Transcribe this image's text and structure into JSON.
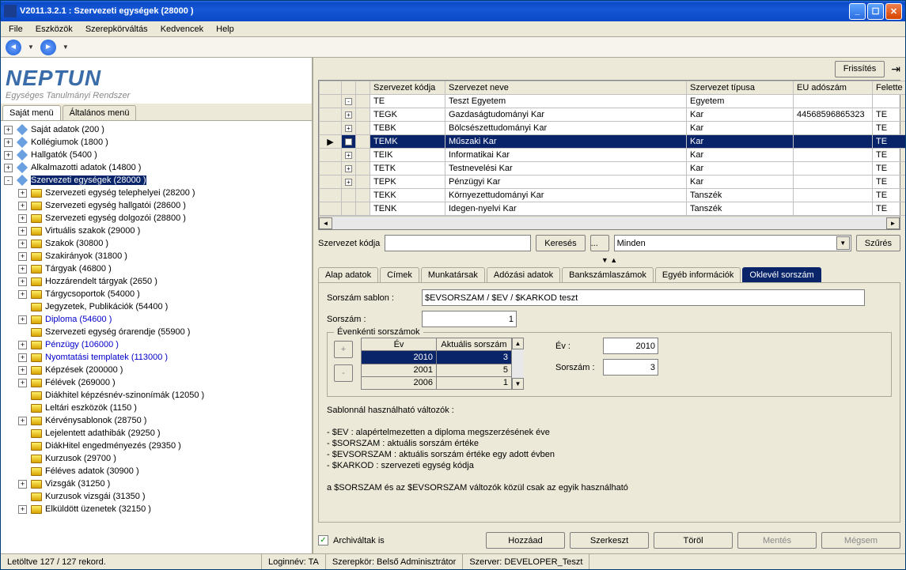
{
  "title": "V2011.3.2.1 : Szervezeti egységek (28000  )",
  "menu": [
    "File",
    "Eszközök",
    "Szerepkörváltás",
    "Kedvencek",
    "Help"
  ],
  "logo": {
    "title": "NEPTUN",
    "subtitle": "Egységes Tanulmányi Rendszer"
  },
  "left_tabs": {
    "own": "Saját menü",
    "general": "Általános menü"
  },
  "tree": [
    {
      "lvl": 0,
      "pm": "+",
      "icon": "diamond",
      "label": "Saját adatok (200  )"
    },
    {
      "lvl": 0,
      "pm": "+",
      "icon": "diamond",
      "label": "Kollégiumok (1800  )"
    },
    {
      "lvl": 0,
      "pm": "+",
      "icon": "diamond",
      "label": "Hallgatók (5400  )"
    },
    {
      "lvl": 0,
      "pm": "+",
      "icon": "diamond",
      "label": "Alkalmazotti adatok (14800  )"
    },
    {
      "lvl": 0,
      "pm": "-",
      "icon": "diamond",
      "label": "Szervezeti egységek (28000  )",
      "sel": true
    },
    {
      "lvl": 1,
      "pm": "+",
      "icon": "folder",
      "label": "Szervezeti egység telephelyei (28200  )"
    },
    {
      "lvl": 1,
      "pm": "+",
      "icon": "folder",
      "label": "Szervezeti egység hallgatói (28600  )"
    },
    {
      "lvl": 1,
      "pm": "+",
      "icon": "folder",
      "label": "Szervezeti egység dolgozói (28800  )"
    },
    {
      "lvl": 1,
      "pm": "+",
      "icon": "folder",
      "label": "Virtuális szakok (29000  )"
    },
    {
      "lvl": 1,
      "pm": "+",
      "icon": "folder",
      "label": "Szakok (30800  )"
    },
    {
      "lvl": 1,
      "pm": "+",
      "icon": "folder",
      "label": "Szakirányok (31800  )"
    },
    {
      "lvl": 1,
      "pm": "+",
      "icon": "folder",
      "label": "Tárgyak (46800  )"
    },
    {
      "lvl": 1,
      "pm": "+",
      "icon": "folder",
      "label": "Hozzárendelt tárgyak (2650  )"
    },
    {
      "lvl": 1,
      "pm": "+",
      "icon": "folder",
      "label": "Tárgycsoportok (54000  )"
    },
    {
      "lvl": 1,
      "pm": "",
      "icon": "folder",
      "label": "Jegyzetek, Publikációk (54400  )"
    },
    {
      "lvl": 1,
      "pm": "+",
      "icon": "folder",
      "label": "Diploma (54600  )",
      "blue": true
    },
    {
      "lvl": 1,
      "pm": "",
      "icon": "folder",
      "label": "Szervezeti egység órarendje (55900  )"
    },
    {
      "lvl": 1,
      "pm": "+",
      "icon": "folder",
      "label": "Pénzügy (106000  )",
      "blue": true
    },
    {
      "lvl": 1,
      "pm": "+",
      "icon": "folder",
      "label": "Nyomtatási templatek (113000  )",
      "blue": true
    },
    {
      "lvl": 1,
      "pm": "+",
      "icon": "folder",
      "label": "Képzések (200000  )"
    },
    {
      "lvl": 1,
      "pm": "+",
      "icon": "folder",
      "label": "Félévek (269000  )"
    },
    {
      "lvl": 1,
      "pm": "",
      "icon": "folder",
      "label": "Diákhitel képzésnév-szinonímák (12050  )"
    },
    {
      "lvl": 1,
      "pm": "",
      "icon": "folder",
      "label": "Leltári eszközök (1150  )"
    },
    {
      "lvl": 1,
      "pm": "+",
      "icon": "folder",
      "label": "Kérvénysablonok (28750  )"
    },
    {
      "lvl": 1,
      "pm": "",
      "icon": "folder",
      "label": "Lejelentett adathibák (29250  )"
    },
    {
      "lvl": 1,
      "pm": "",
      "icon": "folder",
      "label": "DiákHitel engedményezés (29350  )"
    },
    {
      "lvl": 1,
      "pm": "",
      "icon": "folder",
      "label": "Kurzusok (29700  )"
    },
    {
      "lvl": 1,
      "pm": "",
      "icon": "folder",
      "label": "Féléves adatok (30900  )"
    },
    {
      "lvl": 1,
      "pm": "+",
      "icon": "folder",
      "label": "Vizsgák (31250  )"
    },
    {
      "lvl": 1,
      "pm": "",
      "icon": "folder",
      "label": "Kurzusok vizsgái (31350  )"
    },
    {
      "lvl": 1,
      "pm": "+",
      "icon": "folder",
      "label": "Elküldött üzenetek (32150  )"
    }
  ],
  "right_toolbar": {
    "refresh": "Frissítés"
  },
  "grid": {
    "headers": [
      "Szervezet kódja",
      "Szervezet neve",
      "Szervezet típusa",
      "EU adószám",
      "Felette"
    ],
    "rows": [
      {
        "pm": "-",
        "code": "TE",
        "name": "Teszt Egyetem",
        "type": "Egyetem",
        "eu": "",
        "par": ""
      },
      {
        "pm": "+",
        "code": "TEGK",
        "name": "Gazdaságtudományi Kar",
        "type": "Kar",
        "eu": "44568596865323",
        "par": "TE"
      },
      {
        "pm": "+",
        "code": "TEBK",
        "name": "Bölcsészettudományi Kar",
        "type": "Kar",
        "eu": "",
        "par": "TE"
      },
      {
        "pm": "+",
        "code": "TEMK",
        "name": "Műszaki Kar",
        "type": "Kar",
        "eu": "",
        "par": "TE",
        "sel": true
      },
      {
        "pm": "+",
        "code": "TEIK",
        "name": "Informatikai Kar",
        "type": "Kar",
        "eu": "",
        "par": "TE"
      },
      {
        "pm": "+",
        "code": "TETK",
        "name": "Testnevelési Kar",
        "type": "Kar",
        "eu": "",
        "par": "TE"
      },
      {
        "pm": "+",
        "code": "TEPK",
        "name": "Pénzügyi Kar",
        "type": "Kar",
        "eu": "",
        "par": "TE"
      },
      {
        "pm": "",
        "code": "TEKK",
        "name": "Környezettudományi Kar",
        "type": "Tanszék",
        "eu": "",
        "par": "TE"
      },
      {
        "pm": "",
        "code": "TENK",
        "name": "Idegen-nyelvi Kar",
        "type": "Tanszék",
        "eu": "",
        "par": "TE"
      }
    ]
  },
  "search": {
    "label": "Szervezet kódja",
    "keres": "Keresés",
    "ell": "...",
    "minden": "Minden",
    "szures": "Szűrés"
  },
  "detail_tabs": [
    "Alap adatok",
    "Címek",
    "Munkatársak",
    "Adózási adatok",
    "Bankszámlaszámok",
    "Egyéb információk",
    "Oklevél sorszám"
  ],
  "detail": {
    "sablon_label": "Sorszám sablon :",
    "sablon_value": "$EVSORSZAM / $EV / $KARKOD teszt",
    "sorszam_label": "Sorszám :",
    "sorszam_value": "1",
    "fs_legend": "Évenkénti sorszámok",
    "year_headers": [
      "Év",
      "Aktuális sorszám"
    ],
    "year_rows": [
      {
        "ev": "2010",
        "s": "3",
        "sel": true
      },
      {
        "ev": "2001",
        "s": "5"
      },
      {
        "ev": "2006",
        "s": "1"
      }
    ],
    "ev_label": "Év :",
    "ev_value": "2010",
    "sorszam2_label": "Sorszám :",
    "sorszam2_value": "3",
    "help_title": "Sablonnál használható változók :",
    "help_lines": [
      "- $EV : alapértelmezetten a diploma megszerzésének éve",
      "- $SORSZAM : aktuális sorszám értéke",
      "- $EVSORSZAM : aktuális sorszám értéke egy adott évben",
      "- $KARKOD : szervezeti egység kódja"
    ],
    "help_note": "a $SORSZAM és az $EVSORSZAM változók közül csak az egyik használható"
  },
  "buttons": {
    "archiv": "Archiváltak is",
    "hozzaad": "Hozzáad",
    "szerkeszt": "Szerkeszt",
    "torol": "Töröl",
    "mentes": "Mentés",
    "megsem": "Mégsem"
  },
  "status": {
    "rec": "Letöltve 127 / 127 rekord.",
    "login": "Loginnév: TA",
    "role": "Szerepkör: Belső Adminisztrátor",
    "server": "Szerver: DEVELOPER_Teszt"
  }
}
